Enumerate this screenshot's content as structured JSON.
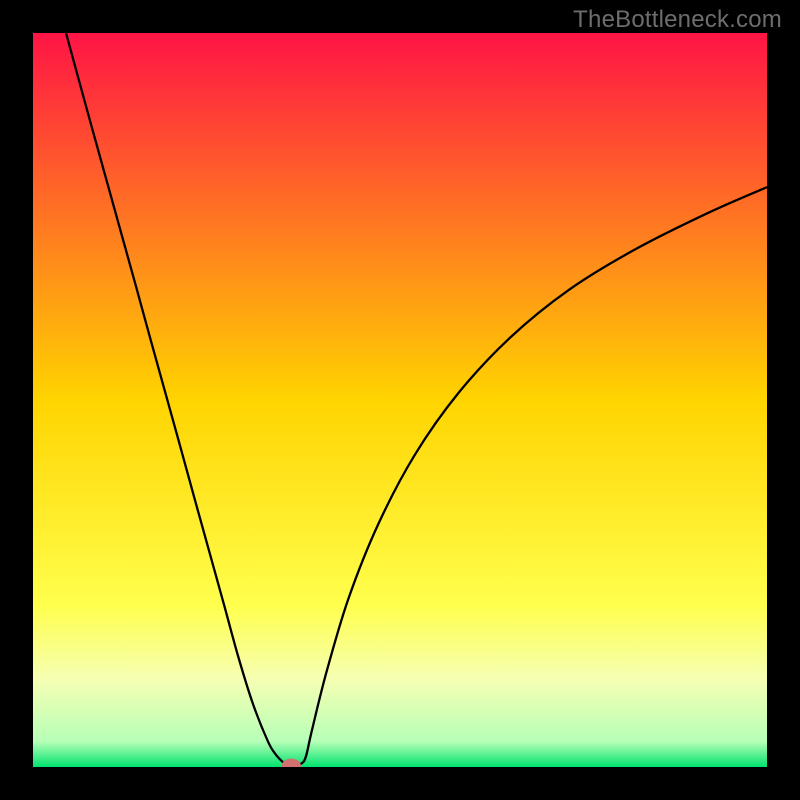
{
  "watermark": "TheBottleneck.com",
  "chart_data": {
    "type": "line",
    "title": "",
    "xlabel": "",
    "ylabel": "",
    "xlim": [
      0,
      100
    ],
    "ylim": [
      0,
      100
    ],
    "gradient_stops": [
      {
        "offset": 0.0,
        "color": "#ff1445"
      },
      {
        "offset": 0.5,
        "color": "#ffd400"
      },
      {
        "offset": 0.78,
        "color": "#ffff4d"
      },
      {
        "offset": 0.88,
        "color": "#f6ffb3"
      },
      {
        "offset": 0.965,
        "color": "#b7ffb7"
      },
      {
        "offset": 1.0,
        "color": "#00e36e"
      }
    ],
    "series": [
      {
        "name": "bottleneck-curve",
        "type": "line",
        "x": [
          4.5,
          6,
          8,
          10,
          12,
          14,
          16,
          18,
          20,
          22,
          24,
          26,
          28,
          30,
          32,
          33,
          34,
          34.5,
          35,
          35.5,
          36.6,
          37.2,
          38,
          40,
          43,
          47,
          52,
          58,
          65,
          73,
          82,
          92,
          100
        ],
        "values": [
          100,
          94.5,
          87.2,
          80,
          72.8,
          65.6,
          58.3,
          51.1,
          43.9,
          36.6,
          29.4,
          22.2,
          14.9,
          8.5,
          3.5,
          1.8,
          0.7,
          0.3,
          0.2,
          0.3,
          0.5,
          1.5,
          5,
          13,
          23,
          33,
          42.5,
          51,
          58.5,
          65,
          70.5,
          75.5,
          79
        ]
      }
    ],
    "marker": {
      "x": 35.2,
      "y": 0.2,
      "rx": 1.3,
      "ry": 0.95,
      "color": "#d17271"
    }
  }
}
